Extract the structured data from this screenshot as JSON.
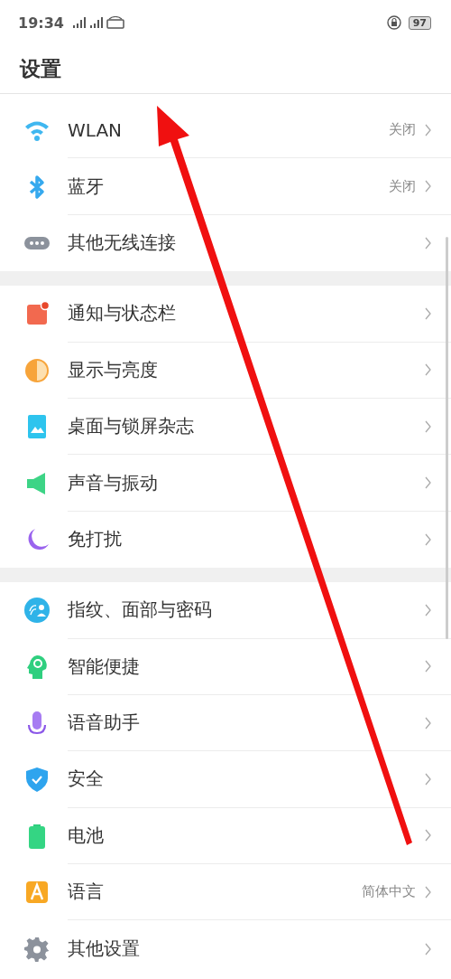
{
  "status_bar": {
    "time": "19:34",
    "battery": "97"
  },
  "title": "设置",
  "sections": [
    {
      "items": [
        {
          "label": "WLAN",
          "value": "关闭"
        },
        {
          "label": "蓝牙",
          "value": "关闭"
        },
        {
          "label": "其他无线连接"
        }
      ]
    },
    {
      "items": [
        {
          "label": "通知与状态栏"
        },
        {
          "label": "显示与亮度"
        },
        {
          "label": "桌面与锁屏杂志"
        },
        {
          "label": "声音与振动"
        },
        {
          "label": "免打扰"
        }
      ]
    },
    {
      "items": [
        {
          "label": "指纹、面部与密码"
        },
        {
          "label": "智能便捷"
        },
        {
          "label": "语音助手"
        },
        {
          "label": "安全"
        },
        {
          "label": "电池"
        },
        {
          "label": "语言",
          "value": "简体中文"
        },
        {
          "label": "其他设置"
        }
      ]
    }
  ]
}
